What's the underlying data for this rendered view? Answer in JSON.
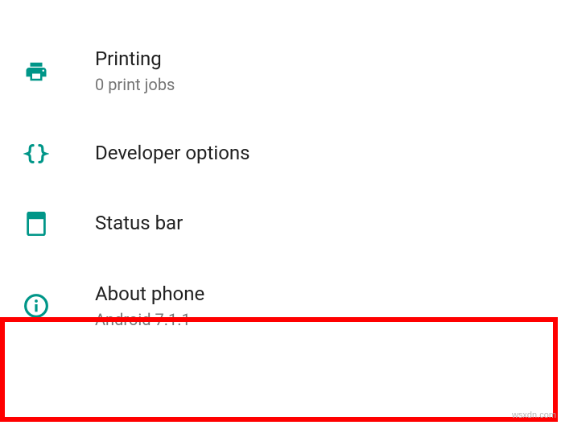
{
  "accent": "#009688",
  "items": [
    {
      "title": "Printing",
      "subtitle": "0 print jobs"
    },
    {
      "title": "Developer options",
      "subtitle": ""
    },
    {
      "title": "Status bar",
      "subtitle": ""
    },
    {
      "title": "About phone",
      "subtitle": "Android 7.1.1"
    }
  ],
  "watermark": "wsxdn.com"
}
